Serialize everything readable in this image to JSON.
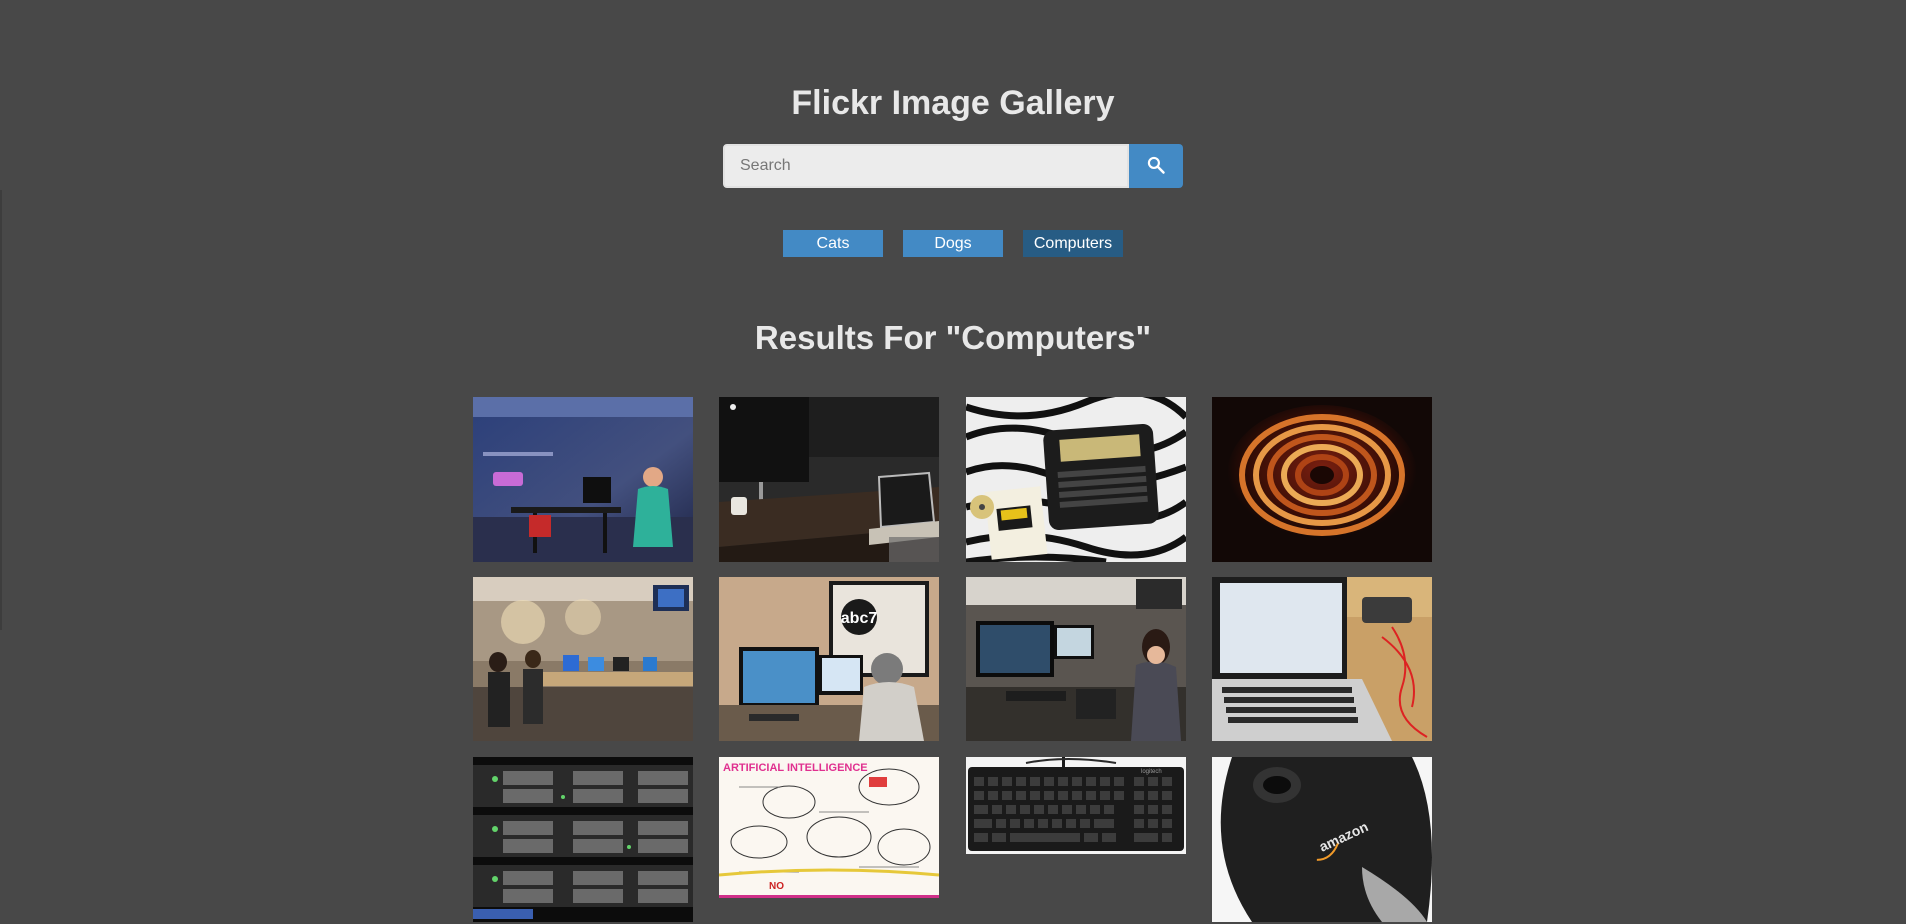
{
  "header": {
    "title": "Flickr Image Gallery"
  },
  "search": {
    "placeholder": "Search",
    "value": "",
    "button_icon": "search-icon"
  },
  "nav": {
    "items": [
      {
        "label": "Cats",
        "active": false
      },
      {
        "label": "Dogs",
        "active": false
      },
      {
        "label": "Computers",
        "active": true
      }
    ]
  },
  "results": {
    "title": "Results For \"Computers\""
  },
  "gallery": {
    "photos": [
      {
        "subject": "man-at-standing-desk-neon-studio"
      },
      {
        "subject": "imac-and-laptop-on-desk"
      },
      {
        "subject": "vintage-laptop-on-zebra-blanket"
      },
      {
        "subject": "copper-coil-closeup"
      },
      {
        "subject": "tv-newsroom-workstations"
      },
      {
        "subject": "editor-at-abc7-desk"
      },
      {
        "subject": "woman-editing-video"
      },
      {
        "subject": "laptop-on-wooden-table"
      },
      {
        "subject": "server-rack-drives"
      },
      {
        "subject": "artificial-intelligence-sketchnote"
      },
      {
        "subject": "black-keyboard"
      },
      {
        "subject": "amazon-computer-mouse"
      }
    ],
    "sketch_text": "ARTIFICIAL INTELLIGENCE",
    "keyboard_brand": "logitech",
    "mouse_brand": "amazon",
    "tv_logo": "abc7"
  },
  "colors": {
    "background": "#484848",
    "accent": "#438ac5",
    "active": "#275c84",
    "text": "#e8e8e8"
  }
}
